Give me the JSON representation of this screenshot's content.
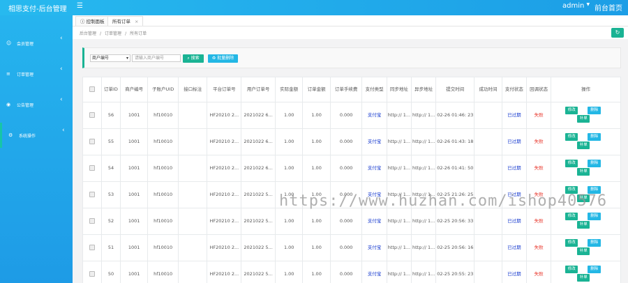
{
  "app": {
    "title": "相思支付-后台管理",
    "user": "admin",
    "frontend_link": "前台首页"
  },
  "sidebar": {
    "items": [
      {
        "label": "会员管理",
        "icon": "user-icon"
      },
      {
        "label": "订单管理",
        "icon": "list-icon"
      },
      {
        "label": "公告管理",
        "icon": "eye-icon"
      },
      {
        "label": "系统操作",
        "icon": "gear-icon"
      }
    ]
  },
  "tabs": [
    {
      "label": "ⓘ 控制面板"
    },
    {
      "label": "所有订单"
    }
  ],
  "breadcrumb": [
    "后台管理",
    "订单管理",
    "所有订单"
  ],
  "filter": {
    "select_value": "商户编号",
    "input_placeholder": "请输入商户编号",
    "search_label": "搜索",
    "batch_label": "批量删除"
  },
  "table": {
    "headers": [
      "订单ID",
      "商户编号",
      "子账户UID",
      "接口标注",
      "平台订单号",
      "用户订单号",
      "实际金额",
      "订单金额",
      "订单手续费",
      "支付类型",
      "同步地址",
      "异步地址",
      "提交时间",
      "成功时间",
      "支付状态",
      "回调状态",
      "操作"
    ],
    "op_labels": {
      "edit": "修改",
      "delete": "删除",
      "fix": "补单"
    },
    "rows": [
      {
        "id": "56",
        "merchant": "1001",
        "uid": "hf10010",
        "mark": "",
        "platform_no": "HF20210 2...",
        "user_no": "2021022 6...",
        "actual": "1.00",
        "amount": "1.00",
        "fee": "0.000",
        "pay_type": "支付宝",
        "sync": "http:// 1...",
        "async": "http:// 1...",
        "submit_time": "02-26 01:46: 23",
        "success_time": "",
        "pay_status": "已过期",
        "cb_status": "失败"
      },
      {
        "id": "55",
        "merchant": "1001",
        "uid": "hf10010",
        "mark": "",
        "platform_no": "HF20210 2...",
        "user_no": "2021022 6...",
        "actual": "1.00",
        "amount": "1.00",
        "fee": "0.000",
        "pay_type": "支付宝",
        "sync": "http:// 1...",
        "async": "http:// 1...",
        "submit_time": "02-26 01:43: 18",
        "success_time": "",
        "pay_status": "已过期",
        "cb_status": "失败"
      },
      {
        "id": "54",
        "merchant": "1001",
        "uid": "hf10010",
        "mark": "",
        "platform_no": "HF20210 2...",
        "user_no": "2021022 6...",
        "actual": "1.00",
        "amount": "1.00",
        "fee": "0.000",
        "pay_type": "支付宝",
        "sync": "http:// 1...",
        "async": "http:// 1...",
        "submit_time": "02-26 01:41: 50",
        "success_time": "",
        "pay_status": "已过期",
        "cb_status": "失败"
      },
      {
        "id": "53",
        "merchant": "1001",
        "uid": "hf10010",
        "mark": "",
        "platform_no": "HF20210 2...",
        "user_no": "2021022 5...",
        "actual": "1.00",
        "amount": "1.00",
        "fee": "0.000",
        "pay_type": "支付宝",
        "sync": "http:// 1...",
        "async": "http:// 1...",
        "submit_time": "02-25 21:26: 25",
        "success_time": "",
        "pay_status": "已过期",
        "cb_status": "失败"
      },
      {
        "id": "52",
        "merchant": "1001",
        "uid": "hf10010",
        "mark": "",
        "platform_no": "HF20210 2...",
        "user_no": "2021022 5...",
        "actual": "1.00",
        "amount": "1.00",
        "fee": "0.000",
        "pay_type": "支付宝",
        "sync": "http:// 1...",
        "async": "http:// 1...",
        "submit_time": "02-25 20:56: 33",
        "success_time": "",
        "pay_status": "已过期",
        "cb_status": "失败"
      },
      {
        "id": "51",
        "merchant": "1001",
        "uid": "hf10010",
        "mark": "",
        "platform_no": "HF20210 2...",
        "user_no": "2021022 5...",
        "actual": "1.00",
        "amount": "1.00",
        "fee": "0.000",
        "pay_type": "支付宝",
        "sync": "http:// 1...",
        "async": "http:// 1...",
        "submit_time": "02-25 20:56: 16",
        "success_time": "",
        "pay_status": "已过期",
        "cb_status": "失败"
      },
      {
        "id": "50",
        "merchant": "1001",
        "uid": "hf10010",
        "mark": "",
        "platform_no": "HF20210 2...",
        "user_no": "2021022 5...",
        "actual": "1.00",
        "amount": "1.00",
        "fee": "0.000",
        "pay_type": "支付宝",
        "sync": "http:// 1...",
        "async": "http:// 1...",
        "submit_time": "02-25 20:55: 23",
        "success_time": "",
        "pay_status": "已过期",
        "cb_status": "失败"
      }
    ]
  },
  "watermark": "https://www.huzhan.com/ishop40576"
}
